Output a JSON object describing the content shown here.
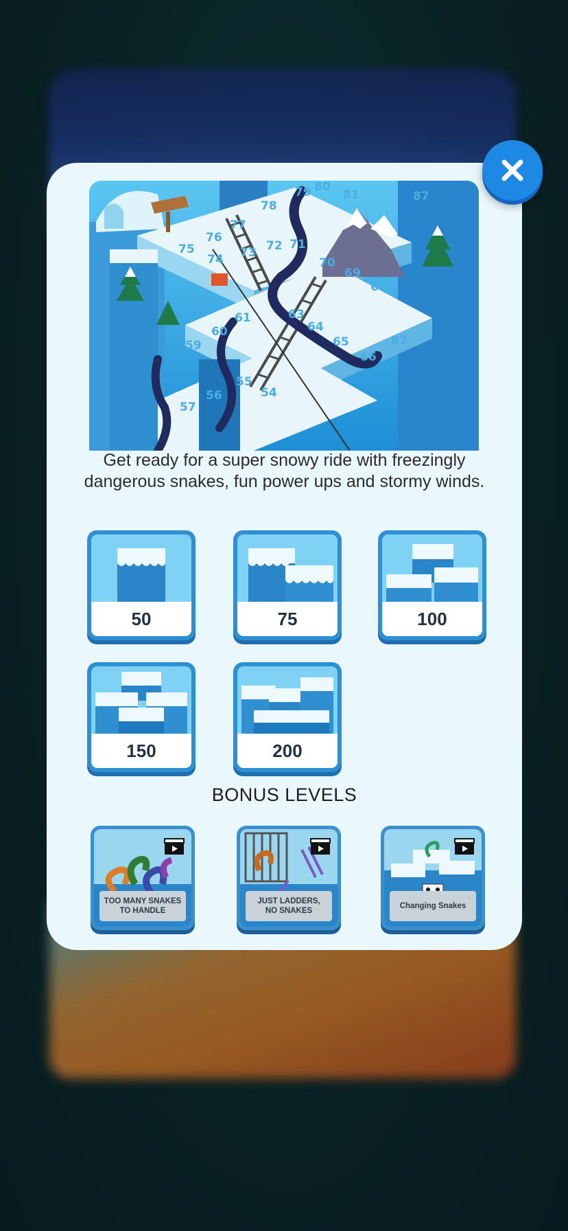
{
  "modal": {
    "description": "Get ready for a super snowy ride with freezingly dangerous snakes, fun power ups and stormy winds.",
    "hero_numbers": [
      "79",
      "80",
      "81",
      "87",
      "78",
      "76",
      "77",
      "75",
      "73",
      "72",
      "71",
      "74",
      "70",
      "69",
      "68",
      "60",
      "61",
      "63",
      "59",
      "64",
      "65",
      "66",
      "87",
      "55",
      "54",
      "57",
      "56"
    ],
    "levels": [
      {
        "label": "50"
      },
      {
        "label": "75"
      },
      {
        "label": "100"
      },
      {
        "label": "150"
      },
      {
        "label": "200"
      }
    ],
    "bonus_title": "BONUS LEVELS",
    "bonus_levels": [
      {
        "label_line1": "TOO MANY SNAKES",
        "label_line2": "TO HANDLE"
      },
      {
        "label_line1": "JUST LADDERS,",
        "label_line2": "NO SNAKES"
      },
      {
        "label_line1": "Changing Snakes",
        "label_line2": ""
      }
    ]
  },
  "colors": {
    "accent": "#1e88e5",
    "modal_bg": "#eaf8fd",
    "tile_border": "#2f8fd3"
  },
  "icons": {
    "close": "close-icon",
    "video": "video-clapper-icon"
  }
}
